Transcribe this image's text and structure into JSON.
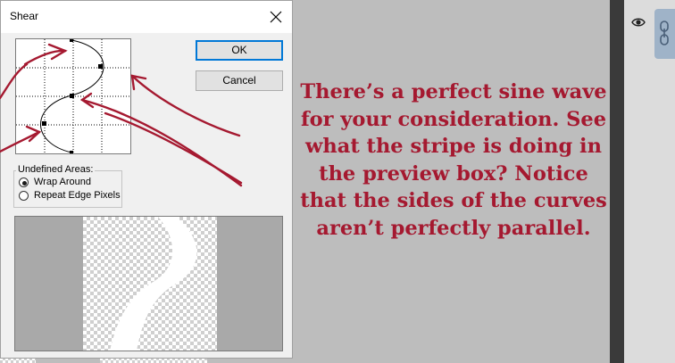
{
  "dialog": {
    "title": "Shear",
    "ok_label": "OK",
    "cancel_label": "Cancel",
    "undefined_areas_label": "Undefined Areas:",
    "options": [
      {
        "label": "Wrap Around",
        "selected": true
      },
      {
        "label": "Repeat Edge Pixels",
        "selected": false
      }
    ]
  },
  "annotation": {
    "text": "There’s a perfect sine wave for your consideration. See what the stripe is doing in the preview box? Notice that the sides of the curves aren’t perfectly parallel.",
    "color": "#a51930"
  },
  "icons": [
    "close-icon",
    "eye-icon",
    "link-icon"
  ],
  "colors": {
    "arrow": "#a51930",
    "ok_border": "#0078d7",
    "link_handle": "#9fb3c8"
  }
}
